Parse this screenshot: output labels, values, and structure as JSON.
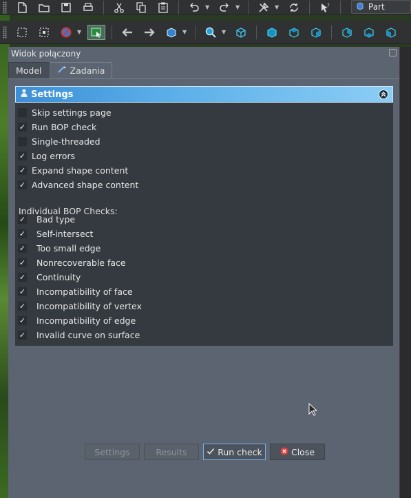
{
  "toolbar": {
    "workbench_label": "Part"
  },
  "panel": {
    "title": "Widok połączony",
    "tabs": [
      {
        "label": "Model"
      },
      {
        "label": "Zadania"
      }
    ]
  },
  "taskbox": {
    "header": "Settings",
    "options": [
      {
        "label": "Skip settings page",
        "checked": false
      },
      {
        "label": "Run BOP check",
        "checked": true
      },
      {
        "label": "Single-threaded",
        "checked": false
      },
      {
        "label": "Log errors",
        "checked": true
      },
      {
        "label": "Expand shape content",
        "checked": true
      },
      {
        "label": "Advanced shape content",
        "checked": true
      }
    ],
    "bop_section_label": "Individual BOP Checks:",
    "bop_checks": [
      {
        "label": "Bad type",
        "checked": true
      },
      {
        "label": "Self-intersect",
        "checked": true
      },
      {
        "label": "Too small edge",
        "checked": true
      },
      {
        "label": "Nonrecoverable face",
        "checked": true
      },
      {
        "label": "Continuity",
        "checked": true
      },
      {
        "label": "Incompatibility of face",
        "checked": true
      },
      {
        "label": "Incompatibility of vertex",
        "checked": true
      },
      {
        "label": "Incompatibility of edge",
        "checked": true
      },
      {
        "label": "Invalid curve on surface",
        "checked": true
      }
    ]
  },
  "buttons": {
    "settings": "Settings",
    "results": "Results",
    "run_check": "Run check",
    "close": "Close"
  },
  "colors": {
    "accent": "#5aaee8",
    "panel_bg": "#5b6470",
    "close_icon": "#e04040"
  }
}
